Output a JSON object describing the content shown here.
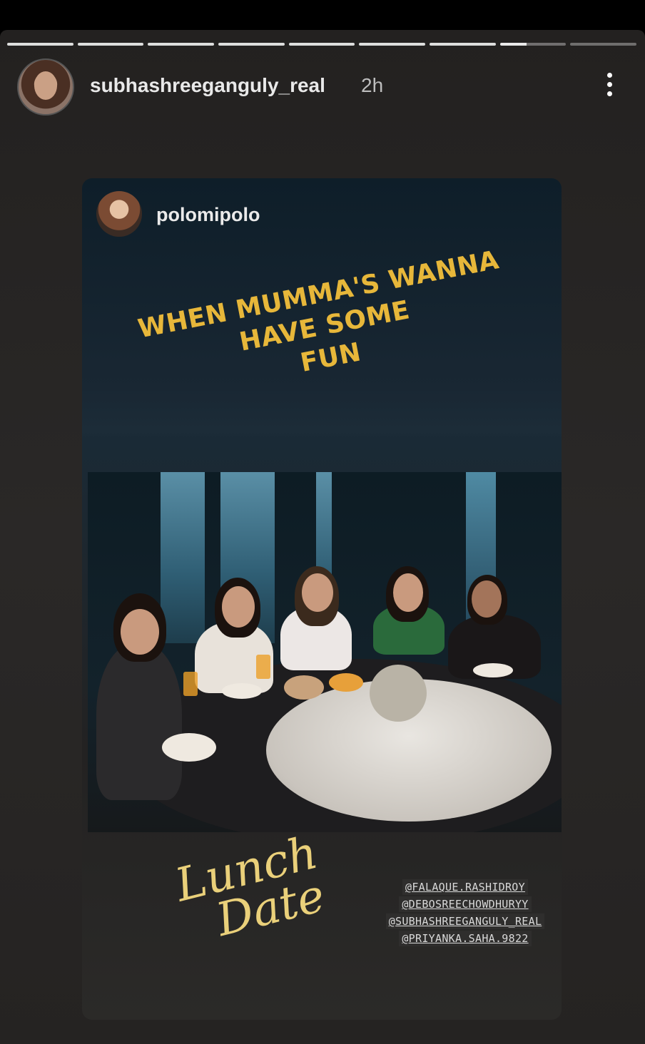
{
  "story": {
    "progress_segments": 9,
    "progress_current_index": 7,
    "username": "subhashreeganguly_real",
    "time": "2h"
  },
  "shared_post": {
    "username": "polomipolo",
    "caption_lines": [
      "WHEN MUMMA'S WANNA HAVE SOME",
      "FUN"
    ],
    "sticker_text_lines": [
      "Lunch",
      "Date"
    ],
    "mentions": [
      "@FALAQUE.RASHIDROY",
      "@DEBOSREECHOWDHURYY",
      "@SUBHASHREEGANGULY_REAL",
      "@PRIYANKA.SAHA.9822"
    ]
  },
  "colors": {
    "caption": "#e7b73a",
    "sticker": "#ead07a"
  },
  "icons": {
    "more": "more-vertical-icon"
  }
}
